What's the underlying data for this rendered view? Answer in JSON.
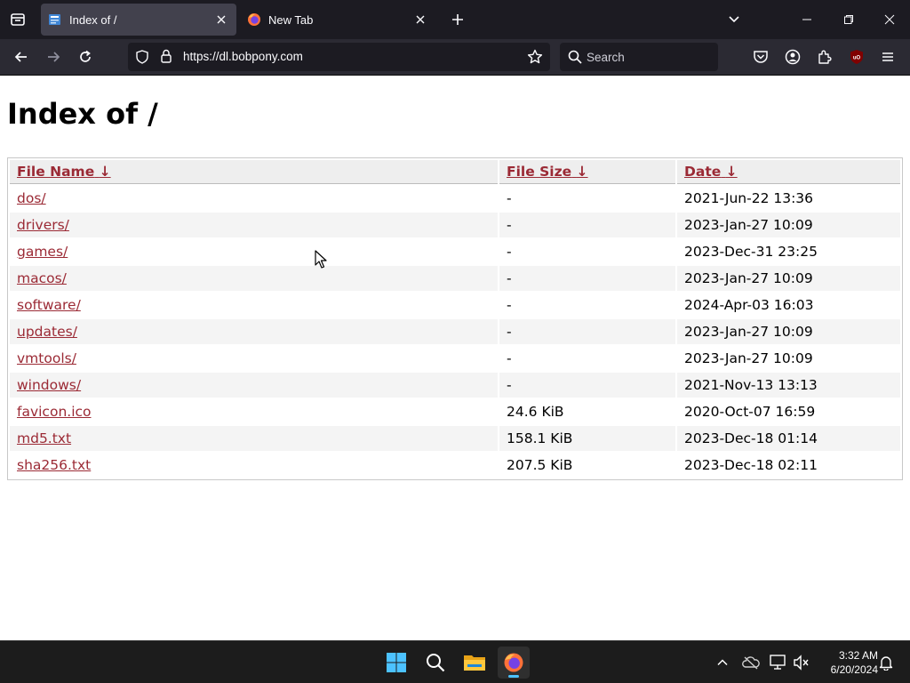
{
  "browser": {
    "tabs": [
      {
        "title": "Index of /",
        "active": true
      },
      {
        "title": "New Tab",
        "active": false
      }
    ],
    "url": "https://dl.bobpony.com",
    "search_placeholder": "Search"
  },
  "page": {
    "heading": "Index of /",
    "columns": [
      {
        "label": "File Name",
        "sort_arrow": "↓"
      },
      {
        "label": "File Size",
        "sort_arrow": "↓"
      },
      {
        "label": "Date",
        "sort_arrow": "↓"
      }
    ],
    "rows": [
      {
        "name": "dos/",
        "size": "-",
        "date": "2021-Jun-22 13:36"
      },
      {
        "name": "drivers/",
        "size": "-",
        "date": "2023-Jan-27 10:09"
      },
      {
        "name": "games/",
        "size": "-",
        "date": "2023-Dec-31 23:25"
      },
      {
        "name": "macos/",
        "size": "-",
        "date": "2023-Jan-27 10:09"
      },
      {
        "name": "software/",
        "size": "-",
        "date": "2024-Apr-03 16:03"
      },
      {
        "name": "updates/",
        "size": "-",
        "date": "2023-Jan-27 10:09"
      },
      {
        "name": "vmtools/",
        "size": "-",
        "date": "2023-Jan-27 10:09"
      },
      {
        "name": "windows/",
        "size": "-",
        "date": "2021-Nov-13 13:13"
      },
      {
        "name": "favicon.ico",
        "size": "24.6 KiB",
        "date": "2020-Oct-07 16:59"
      },
      {
        "name": "md5.txt",
        "size": "158.1 KiB",
        "date": "2023-Dec-18 01:14"
      },
      {
        "name": "sha256.txt",
        "size": "207.5 KiB",
        "date": "2023-Dec-18 02:11"
      }
    ]
  },
  "taskbar": {
    "time": "3:32 AM",
    "date": "6/20/2024"
  },
  "icons": {
    "tab_list": "tab-list-icon",
    "back": "back-arrow-icon",
    "forward": "forward-arrow-icon",
    "reload": "reload-icon",
    "shield": "tracking-shield-icon",
    "lock": "lock-icon",
    "star": "bookmark-star-icon",
    "pocket": "pocket-icon",
    "account": "account-icon",
    "extensions": "extensions-icon",
    "ublock": "ublock-origin-icon",
    "menu": "hamburger-menu-icon"
  },
  "colors": {
    "link": "#9b2a35",
    "chrome_dark": "#1c1b22",
    "toolbar": "#2b2a33",
    "active_tab": "#42414d",
    "taskbar": "#1c1c1c",
    "accent": "#4cc2ff"
  }
}
